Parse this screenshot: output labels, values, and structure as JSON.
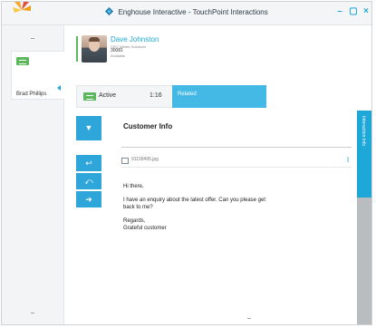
{
  "window": {
    "title": "Enghouse Interactive - TouchPoint Interactions",
    "controls": [
      "–",
      "▢",
      "×"
    ]
  },
  "sidebar": {
    "contact_name": "Brad Phillips"
  },
  "contact": {
    "name": "Dave Johnston",
    "company": "CEO Infinite Solutions",
    "id": "30081",
    "status": "Available"
  },
  "tabs": {
    "active_label": "Active",
    "active_time": "1:16",
    "related_label": "Related"
  },
  "panel": {
    "section_title": "Customer Info",
    "attachment_name": "91199495.jpg",
    "side_tab_label": "Interaction Info",
    "message": {
      "greeting": "Hi there,",
      "line1": "I have an enquiry about the latest offer. Can you please get",
      "line2": "back to me?",
      "closing": "Regards,",
      "signature": "Grateful customer"
    }
  },
  "icons": {
    "dropdown": "▼",
    "reply": "↩",
    "reply_all": "⤺",
    "forward": "➜",
    "attachment_clip": "⌇"
  },
  "colors": {
    "accent": "#1da8d8",
    "active_green": "#5cb85c",
    "related_tab": "#45b9e6"
  }
}
